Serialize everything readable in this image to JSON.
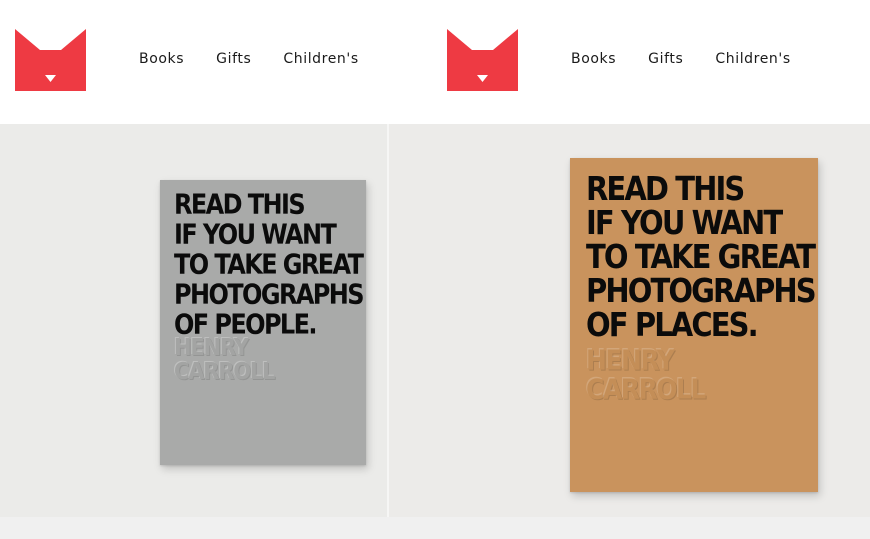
{
  "brand": {
    "logo_icon": "k-logo-icon",
    "logo_color": "#ee3a43"
  },
  "nav": {
    "items": [
      {
        "label": "Books"
      },
      {
        "label": "Gifts"
      },
      {
        "label": "Children's"
      }
    ]
  },
  "products": [
    {
      "cover_color": "#a9aaa9",
      "title_lines": [
        "READ THIS",
        "IF YOU WANT",
        "TO TAKE GREAT",
        "PHOTOGRAPHS",
        "OF PEOPLE."
      ],
      "author_lines": [
        "HENRY",
        "CARROLL"
      ]
    },
    {
      "cover_color": "#c9935d",
      "title_lines": [
        "READ THIS",
        "IF YOU WANT",
        "TO TAKE GREAT",
        "PHOTOGRAPHS",
        "OF PLACES."
      ],
      "author_lines": [
        "HENRY",
        "CARROLL"
      ]
    }
  ]
}
